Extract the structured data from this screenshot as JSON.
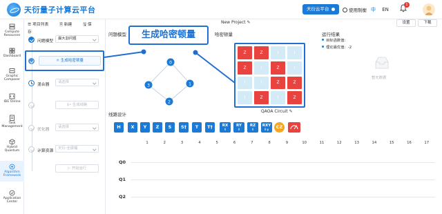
{
  "header": {
    "app_title": "天衍量子计算云平台",
    "platform_button": "天衍云平台",
    "help": "使用制衡",
    "lang_zh": "中",
    "lang_en": "EN",
    "notification_count": "1"
  },
  "nav": [
    {
      "label1": "Compute",
      "label2": "Resources",
      "icon": "server-icon"
    },
    {
      "label1": "Dashboard",
      "label2": "",
      "icon": "dashboard-icon"
    },
    {
      "label1": "Graphic",
      "label2": "Composer",
      "icon": "composer-icon"
    },
    {
      "label1": "IDE Online",
      "label2": "",
      "icon": "code-icon"
    },
    {
      "label1": "Task",
      "label2": "Management",
      "icon": "task-icon"
    },
    {
      "label1": "Hybrid",
      "label2": "Quantum",
      "icon": "cube-icon"
    },
    {
      "label1": "Algorithm",
      "label2": "Framework",
      "icon": "algorithm-icon"
    },
    {
      "label1": "Application",
      "label2": "Center",
      "icon": "app-icon"
    }
  ],
  "toolbar": {
    "project_list": "项目列表",
    "new": "新建",
    "save": "保存"
  },
  "project": {
    "title": "New Project"
  },
  "top_buttons": {
    "settings": "设置",
    "download": "下载"
  },
  "workflow": {
    "problem_label": "问题模型",
    "problem_value": "最大割问题",
    "generate_hamiltonian": "生成哈密顿量",
    "mixer_label": "混合器",
    "mixer_placeholder": "请选择",
    "generate_circuit": "生成线路",
    "optimizer_label": "优化器",
    "optimizer_placeholder": "请选择",
    "resource_label": "计算资源",
    "resource_placeholder": "天衍-全振幅",
    "run": "开始运行"
  },
  "sections": {
    "problem_model": "问题模型",
    "hamiltonian": "哈密顿量",
    "results": "运行结果",
    "circuit_design": "线路设计"
  },
  "callout": "生成哈密顿量",
  "graph_nodes": [
    "0",
    "1",
    "2",
    "3"
  ],
  "matrix": [
    [
      "Z",
      "Z",
      "I",
      "I"
    ],
    [
      "Z",
      "I",
      "Z",
      "I"
    ],
    [
      "I",
      "I",
      "Z",
      "Z"
    ],
    [
      "I",
      "Z",
      "I",
      "Z"
    ]
  ],
  "qaoa_label": "QAOA Circuit",
  "results": {
    "objective": "目标函数值：",
    "theoretical": "理论最优值：-2",
    "no_data": "暂无数据"
  },
  "gates": [
    "H",
    "X",
    "Y",
    "Z",
    "S",
    "S†",
    "T",
    "T†",
    "RX",
    "RY",
    "RZ",
    "RXY",
    "CZ",
    "M"
  ],
  "gate_sub": {
    "RX": "θ",
    "RY": "θ",
    "RZ": "θ",
    "RXY": "θ φ"
  },
  "columns": [
    "1",
    "2",
    "3",
    "4",
    "5",
    "6",
    "7",
    "8",
    "9",
    "10",
    "11",
    "12",
    "13",
    "14",
    "15",
    "16",
    "17"
  ],
  "qubits": [
    "Q0",
    "Q1",
    "Q2"
  ],
  "colors": {
    "accent": "#1a7ad6",
    "highlight": "#1f6fd1",
    "z_cell": "#e8433f",
    "i_cell": "#d3ebf7",
    "cz": "#f5a623"
  }
}
